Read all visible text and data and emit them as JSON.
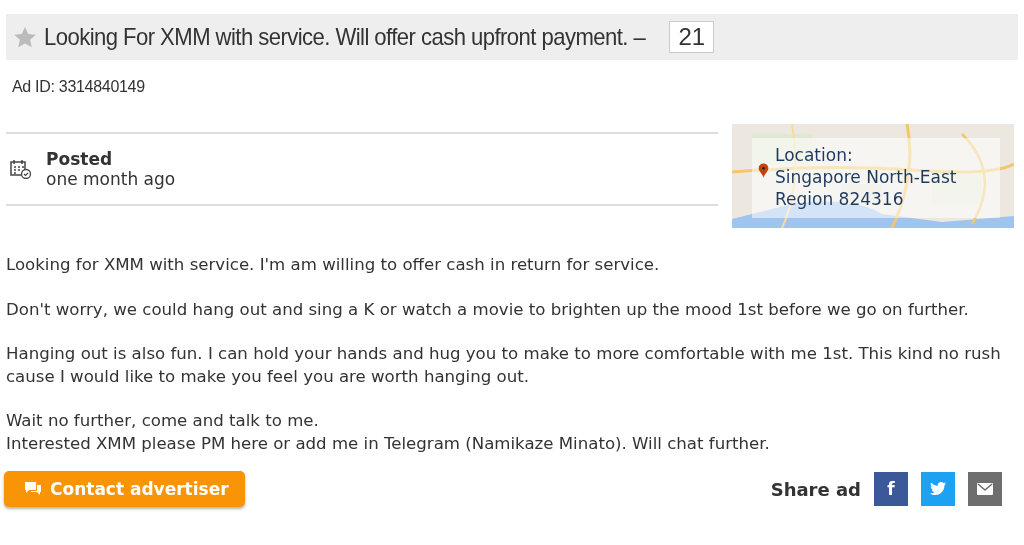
{
  "title": {
    "text": "Looking For XMM with service. Will offer cash upfront payment. –",
    "count": "21",
    "starred": false
  },
  "ad_id": "Ad ID: 3314840149",
  "posted": {
    "label": "Posted",
    "value": "one month ago"
  },
  "location": {
    "label": "Location:",
    "value": "Singapore North-East Region 824316"
  },
  "description": [
    "Looking for XMM with service. I'm am willing to offer cash in return for service.",
    "Don't worry, we could hang out and sing a K or watch a movie to brighten up the mood 1st before we go on further.",
    "Hanging out is also fun. I can hold your hands and hug you to make to more comfortable with me 1st. This kind no rush cause I would like to make you feel you are worth hanging out.",
    "Wait no further, come and talk to me.\nInterested XMM please PM here or add me in Telegram (Namikaze Minato). Will chat further."
  ],
  "contact_button": "Contact advertiser",
  "share": {
    "label": "Share ad",
    "buttons": [
      {
        "kind": "facebook",
        "text": "f"
      },
      {
        "kind": "twitter"
      },
      {
        "kind": "email"
      }
    ]
  }
}
